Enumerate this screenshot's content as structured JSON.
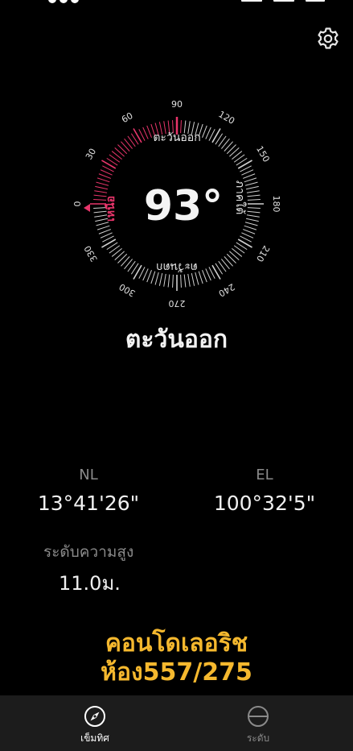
{
  "compass": {
    "heading_value": "93°",
    "heading_deg": 93,
    "cardinal_top": "ตะวันออก",
    "cardinal_right": "ภาคใต้",
    "cardinal_bottom": "ตะวันตก",
    "cardinal_left": "เหนือ",
    "tick_labels": [
      "0",
      "30",
      "60",
      "90",
      "120",
      "150",
      "180",
      "210",
      "240",
      "270",
      "300",
      "330"
    ]
  },
  "direction_name": "ตะวันออก",
  "latitude": {
    "label": "NL",
    "value": "13°41'26\""
  },
  "longitude": {
    "label": "EL",
    "value": "100°32'5\""
  },
  "altitude": {
    "label": "ระดับความสูง",
    "value": "11.0ม."
  },
  "location": {
    "line1": "คอนโดเลอริช",
    "line2": "ห้อง557/275"
  },
  "tabs": [
    {
      "label": "เข็มทิศ",
      "icon": "compass-icon",
      "active": true
    },
    {
      "label": "ระดับ",
      "icon": "level-icon",
      "active": false
    }
  ],
  "icons": {
    "settings": "gear-icon"
  },
  "colors": {
    "accent": "#e8356b",
    "location": "#f5b82e",
    "background": "#000000",
    "tabbar": "#1c1c1c"
  }
}
